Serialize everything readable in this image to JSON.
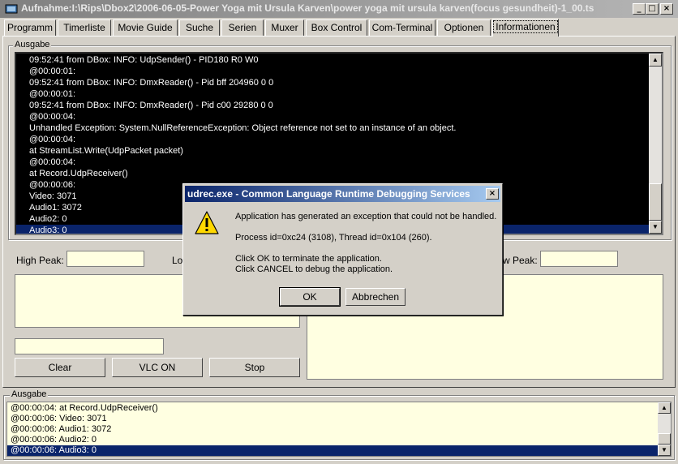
{
  "window": {
    "title": "Aufnahme:I:\\Rips\\Dbox2\\2006-06-05-Power Yoga mit Ursula Karven\\power yoga mit ursula karven(focus gesundheit)-1_00.ts",
    "minimize": "_",
    "maximize": "□",
    "close": "×"
  },
  "tabs": [
    {
      "label": "Programm"
    },
    {
      "label": "Timerliste"
    },
    {
      "label": "Movie Guide"
    },
    {
      "label": "Suche"
    },
    {
      "label": "Serien"
    },
    {
      "label": "Muxer"
    },
    {
      "label": "Box Control"
    },
    {
      "label": "Com-Terminal"
    },
    {
      "label": "Optionen"
    },
    {
      "label": "Informationen"
    }
  ],
  "output_top": {
    "legend": "Ausgabe",
    "marker": ">",
    "lines": [
      "09:52:41  from DBox: INFO: UdpSender() - PID180 R0 W0",
      "@00:00:01:",
      "09:52:41  from DBox: INFO: DmxReader() - Pid bff 204960 0 0",
      "@00:00:01:",
      "09:52:41  from DBox: INFO: DmxReader() - Pid c00 29280 0 0",
      "@00:00:04:",
      "Unhandled Exception: System.NullReferenceException: Object reference not set to an instance of an object.",
      "@00:00:04:",
      "   at StreamList.Write(UdpPacket packet)",
      "@00:00:04:",
      "   at Record.UdpReceiver()",
      "@00:00:06:",
      "Video: 3071",
      "Audio1: 3072",
      "Audio2: 0",
      "Audio3: 0"
    ]
  },
  "peaks": {
    "high_label": "High Peak:",
    "low_label": "Lo",
    "low_right_label": "w Peak:"
  },
  "controls": {
    "clear": "Clear",
    "vlc": "VLC ON",
    "stop": "Stop"
  },
  "output_bottom": {
    "legend": "Ausgabe",
    "lines": [
      "@00:00:04:    at Record.UdpReceiver()",
      "@00:00:06: Video: 3071",
      "@00:00:06: Audio1: 3072",
      "@00:00:06: Audio2: 0",
      "@00:00:06: Audio3: 0"
    ]
  },
  "dialog": {
    "title": "udrec.exe - Common Language Runtime Debugging Services",
    "close": "×",
    "line1": "Application has generated an exception that could not be handled.",
    "line2": "Process id=0xc24 (3108), Thread id=0x104 (260).",
    "line3": "Click OK to terminate the application.",
    "line4": "Click CANCEL to debug the application.",
    "ok": "OK",
    "cancel": "Abbrechen"
  }
}
